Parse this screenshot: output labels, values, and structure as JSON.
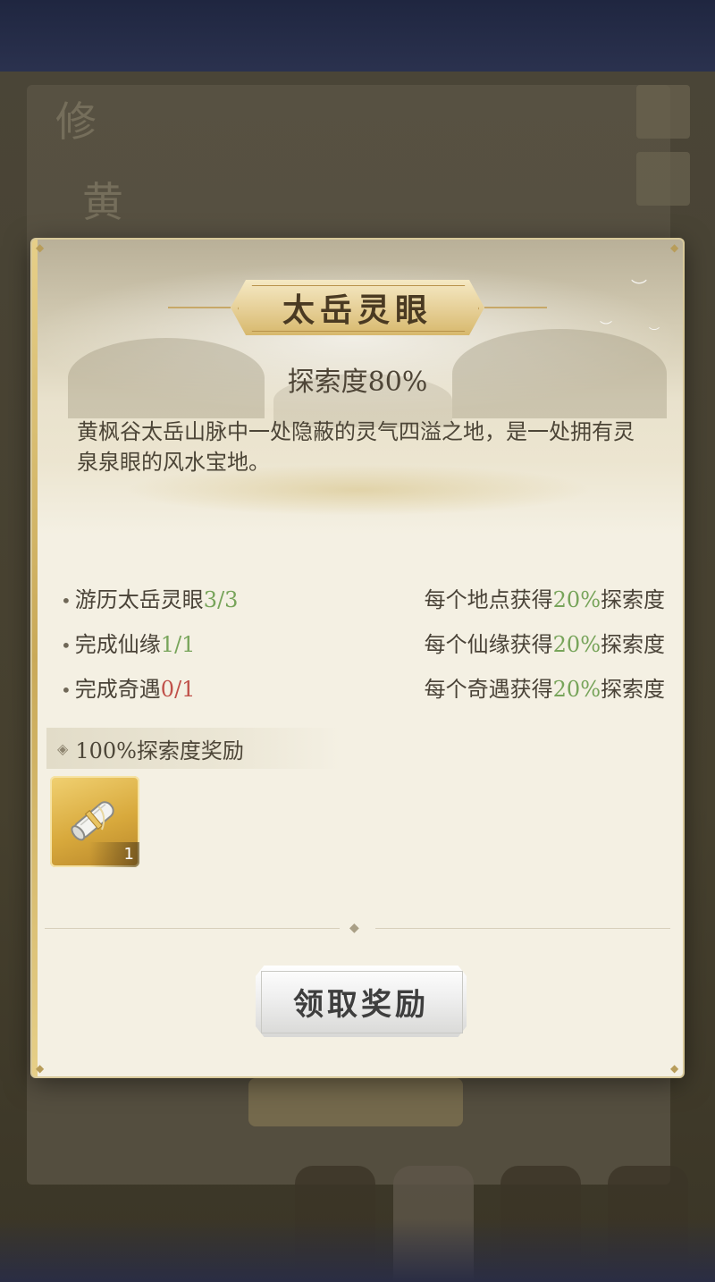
{
  "background": {
    "glyph_1": "修",
    "glyph_2": "黄"
  },
  "modal": {
    "title": "太岳灵眼",
    "exploration": "探索度80%",
    "description": "黄枫谷太岳山脉中一处隐蔽的灵气四溢之地，是一处拥有灵泉泉眼的风水宝地。",
    "tasks": [
      {
        "label": "游历太岳灵眼",
        "progress": "3/3",
        "progress_color": "green",
        "reward_prefix": "每个地点获得",
        "reward_pct": "20%",
        "reward_suffix": "探索度"
      },
      {
        "label": "完成仙缘",
        "progress": "1/1",
        "progress_color": "green",
        "reward_prefix": "每个仙缘获得",
        "reward_pct": "20%",
        "reward_suffix": "探索度"
      },
      {
        "label": "完成奇遇",
        "progress": "0/1",
        "progress_color": "red",
        "reward_prefix": "每个奇遇获得",
        "reward_pct": "20%",
        "reward_suffix": "探索度"
      }
    ],
    "reward_section_title": "100%探索度奖励",
    "reward_items": [
      {
        "icon": "scroll-icon",
        "count": "1"
      }
    ],
    "claim_button": "领取奖励"
  },
  "colors": {
    "green": "#77a45a",
    "red": "#c0514a",
    "gold": "#d8a93c"
  }
}
